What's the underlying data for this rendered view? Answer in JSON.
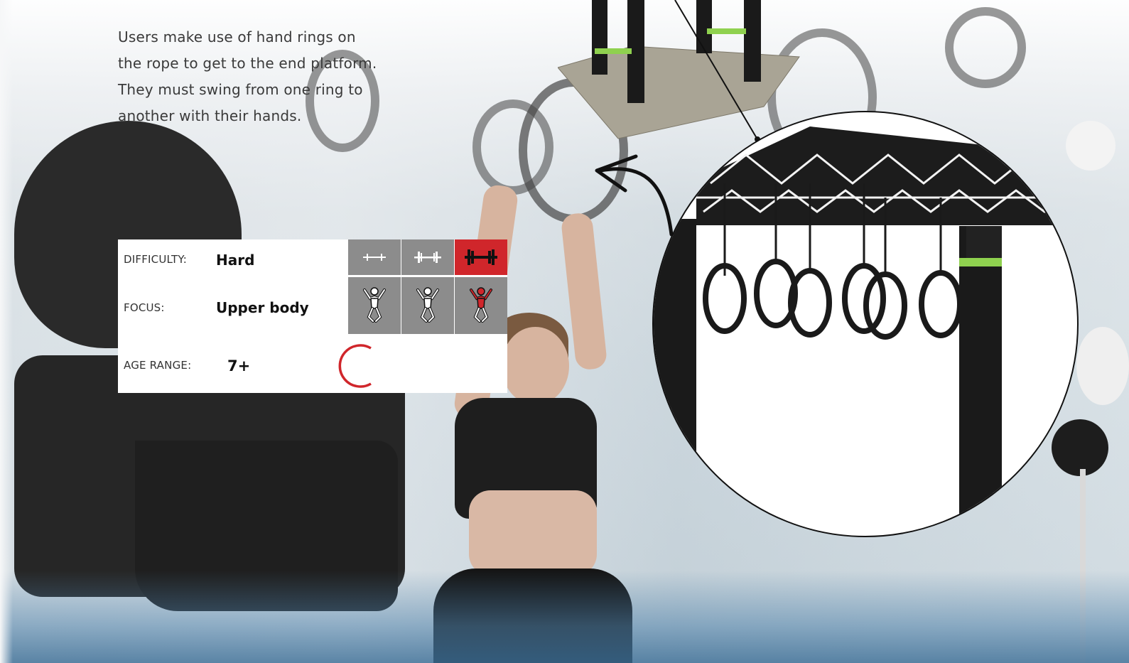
{
  "description": {
    "lines": [
      "Users make use of hand rings on",
      "the rope to get to the end platform.",
      "They must swing from one ring to",
      "another with their hands."
    ]
  },
  "info_card": {
    "difficulty_label": "DIFFICULTY:",
    "difficulty_value": "Hard",
    "focus_label": "FOCUS:",
    "focus_value": "Upper body",
    "age_label": "AGE RANGE:",
    "age_value": "7+",
    "difficulty_levels": [
      "easy-dumbbell-icon",
      "medium-dumbbell-icon",
      "hard-dumbbell-icon"
    ],
    "difficulty_selected_level": 3,
    "focus_levels": [
      "lower-body-figure-icon",
      "full-body-figure-icon",
      "upper-body-figure-icon"
    ],
    "focus_selected_level": 3
  },
  "colors": {
    "accent_red": "#d0262b",
    "cell_gray": "#8c8c8c",
    "frame_black": "#1a1a1a",
    "frame_green": "#8fd14f",
    "platform_gray": "#a9a495"
  }
}
